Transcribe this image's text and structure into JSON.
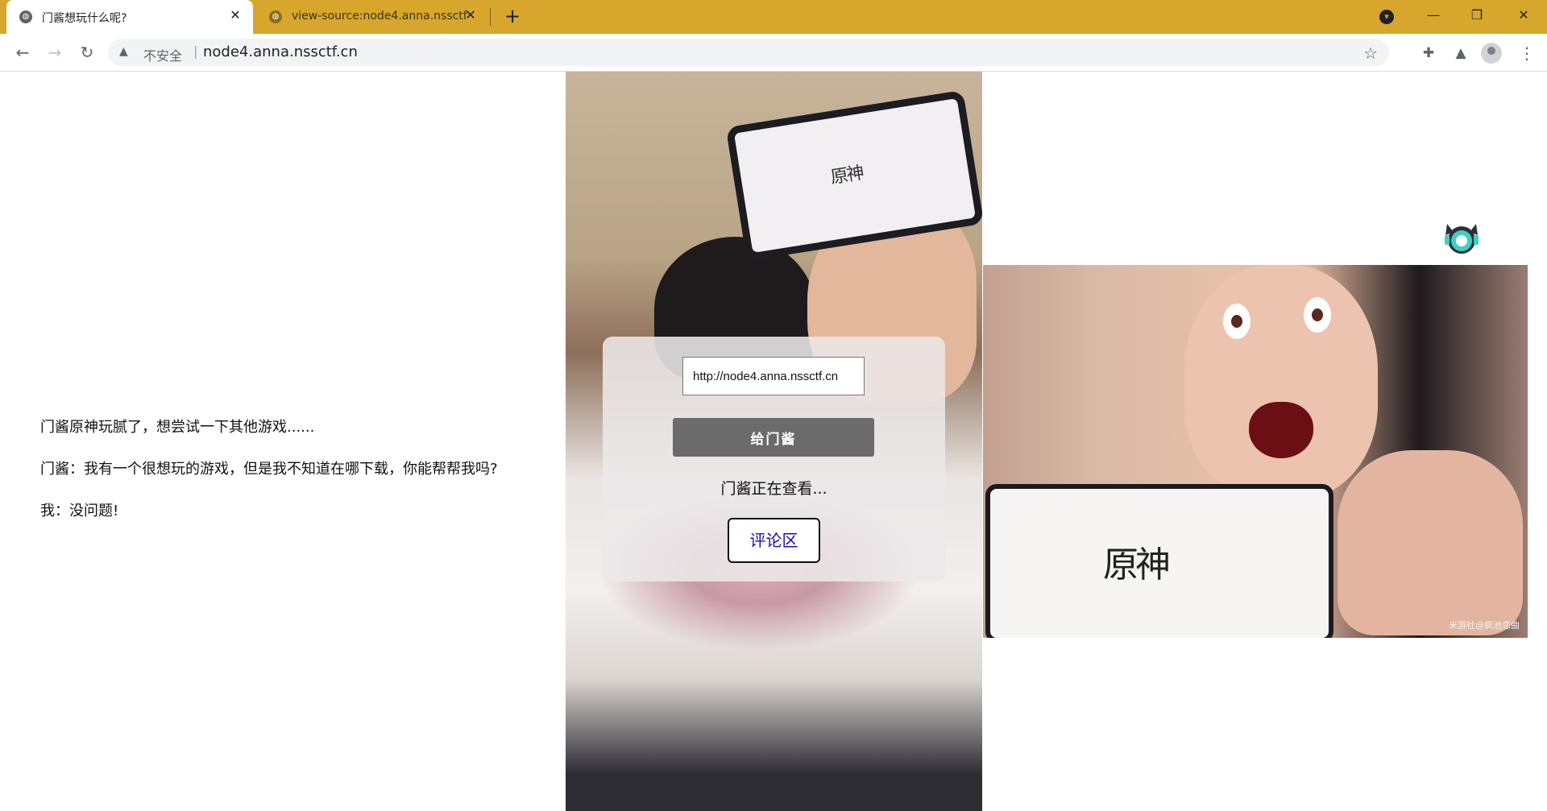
{
  "browser": {
    "tabs": [
      {
        "title": "门酱想玩什么呢?",
        "active": true
      },
      {
        "title": "view-source:node4.anna.nssctf.cn",
        "active": false
      }
    ],
    "security_label": "不安全",
    "url": "node4.anna.nssctf.cn",
    "theme_color": "#d6a72c"
  },
  "page": {
    "story": [
      "门酱原神玩腻了，想尝试一下其他游戏......",
      "门酱：我有一个很想玩的游戏，但是我不知道在哪下载，你能帮帮我吗?",
      "我：没问题!"
    ],
    "form": {
      "input_value": "http://node4.anna.nssctf.cn",
      "button_label": "给门酱"
    },
    "status": "门酱正在查看...",
    "comment_link": "评论区",
    "phone_logo_left": "原神",
    "phone_logo_right": "原神",
    "watermark": "米游社@疯池恋曲"
  }
}
